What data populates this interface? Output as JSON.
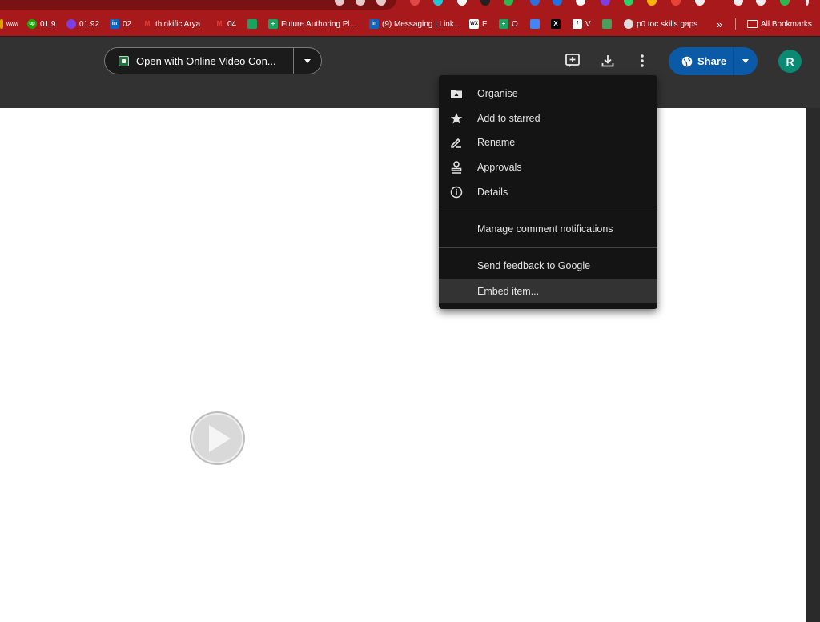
{
  "bookmarks": {
    "items": [
      {
        "label": "www",
        "icon": "bookmark-icon",
        "color": "#e0a000"
      },
      {
        "label": "01.9",
        "icon": "upwork-icon",
        "color": "#14a800"
      },
      {
        "label": "01.92",
        "icon": "gear-icon",
        "color": "#7b3fe4"
      },
      {
        "label": "02",
        "icon": "linkedin-icon",
        "color": "#0a66c2"
      },
      {
        "label": "thinkific Arya",
        "icon": "gmail-icon",
        "color": "#ea4335"
      },
      {
        "label": "04",
        "icon": "gmail-icon",
        "color": "#ea4335"
      },
      {
        "label": "",
        "icon": "forms-icon",
        "color": "#1aa260"
      },
      {
        "label": "Future Authoring Pl...",
        "icon": "plus-icon",
        "color": "#1aa260"
      },
      {
        "label": "(9) Messaging | Link...",
        "icon": "linkedin-icon",
        "color": "#0a66c2"
      },
      {
        "label": "E",
        "icon": "wix-icon",
        "color": "#ffffff"
      },
      {
        "label": "O",
        "icon": "plus-icon",
        "color": "#1aa260"
      },
      {
        "label": "",
        "icon": "calendar-icon",
        "color": "#4285f4"
      },
      {
        "label": "",
        "icon": "x-icon",
        "color": "#000000"
      },
      {
        "label": "V",
        "icon": "edit-icon",
        "color": "#ffffff"
      },
      {
        "label": "",
        "icon": "person-icon",
        "color": "#4a9e5c"
      },
      {
        "label": "p0 toc skills gaps",
        "icon": "cloud-icon",
        "color": "#dddddd"
      }
    ],
    "overflow": "»",
    "all_bookmarks": "All Bookmarks"
  },
  "header": {
    "open_with_label": "Open with Online Video Con...",
    "share_label": "Share",
    "avatar_initial": "R"
  },
  "menu": {
    "items": [
      {
        "label": "Organise",
        "icon": "folder-icon"
      },
      {
        "label": "Add to starred",
        "icon": "star-icon"
      },
      {
        "label": "Rename",
        "icon": "pencil-icon"
      },
      {
        "label": "Approvals",
        "icon": "stamp-icon"
      },
      {
        "label": "Details",
        "icon": "info-icon"
      },
      {
        "label": "Manage comment notifications",
        "icon": ""
      },
      {
        "label": "Send feedback to Google",
        "icon": ""
      },
      {
        "label": "Embed item...",
        "icon": ""
      }
    ]
  },
  "colors": {
    "bookmark_bar": "#a8191c",
    "header": "#323232",
    "menu_bg": "#141414",
    "share": "#0a5aa8",
    "avatar": "#0b8a73"
  }
}
